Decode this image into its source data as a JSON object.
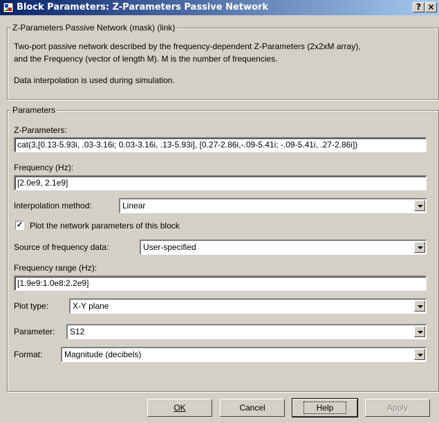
{
  "window": {
    "title": "Block Parameters: Z-Parameters Passive Network",
    "help_button": "?",
    "close_button": "×"
  },
  "description": {
    "legend": "Z-Parameters Passive Network (mask) (link)",
    "line1": "Two-port passive network described by the frequency-dependent Z-Parameters (2x2xM array),",
    "line2": "and the Frequency (vector of length M).  M is the number of frequencies.",
    "line3": "Data interpolation is used during simulation."
  },
  "parameters": {
    "legend": "Parameters",
    "z_params_label": "Z-Parameters:",
    "z_params_value": "cat(3,[0.13-5.93i, .03-3.16i; 0.03-3.16i, .13-5.93i], [0.27-2.86i,-.09-5.41i; -.09-5.41i, .27-2.86i])",
    "frequency_label": "Frequency (Hz):",
    "frequency_value": "[2.0e9, 2.1e9]",
    "interp_label": "Interpolation method:",
    "interp_value": "Linear",
    "plot_checkbox_label": "Plot the network parameters of this block",
    "plot_checked": true,
    "source_label": "Source of frequency data:",
    "source_value": "User-specified",
    "freq_range_label": "Frequency range (Hz):",
    "freq_range_value": "[1.9e9:1.0e8:2.2e9]",
    "plot_type_label": "Plot type:",
    "plot_type_value": "X-Y plane",
    "parameter_label": "Parameter:",
    "parameter_value": "S12",
    "format_label": "Format:",
    "format_value": "Magnitude (decibels)"
  },
  "buttons": {
    "ok": "OK",
    "cancel": "Cancel",
    "help": "Help",
    "apply": "Apply"
  }
}
